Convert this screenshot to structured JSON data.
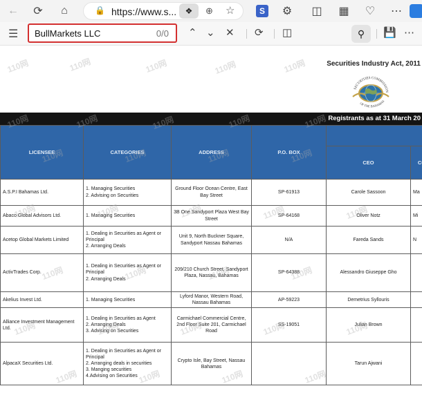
{
  "browser": {
    "url": "https://www.s...",
    "tab_icon_letter": "S"
  },
  "find": {
    "query": "BullMarkets LLC",
    "count": "0/0"
  },
  "document": {
    "act_title": "Securities Industry Act, 2011",
    "seal_top_text": "SECURITIES COMMISSION",
    "seal_bottom_text": "OF THE BAHAMAS",
    "registrants_label": "Registrants as at 31 March 20",
    "watermark": "110网",
    "headers": {
      "licensee": "LICENSEE",
      "categories": "CATEGORIES",
      "address": "ADDRESS",
      "po_box": "P.O. BOX",
      "ceo": "CEO",
      "co": "CO"
    },
    "rows": [
      {
        "licensee": "A.S.P.I Bahamas Ltd.",
        "categories": [
          "1. Managing Securities",
          "2. Advising on Securities"
        ],
        "address": "Ground Floor Ocean Centre, East Bay Street",
        "po_box": "SP-61913",
        "ceo": "Carole Sassoon",
        "co": "Ma"
      },
      {
        "licensee": "Abaco Global Advisors Ltd.",
        "categories": [
          "1. Managing Securities"
        ],
        "address": "3B One Sandyport Plaza West Bay Street",
        "po_box": "SP-64168",
        "ceo": "Oliver Notz",
        "co": "Mi"
      },
      {
        "licensee": "Acetop Global Markets Limited",
        "categories": [
          "1. Dealing in Securities as Agent or Principal",
          "2. Arranging Deals"
        ],
        "address": "Unit 9, North Buckner Square, Sandyport Nassau Bahamas",
        "po_box": "N/A",
        "ceo": "Fareda Sands",
        "co": "N"
      },
      {
        "licensee": "ActivTrades Corp.",
        "categories": [
          "1. Dealing in Securities as Agent or Principal",
          "2. Arranging Deals"
        ],
        "address": "209/210 Church Street, Sandyport Plaza, Nassau, Bahamas",
        "po_box": "SP-64388",
        "ceo": "Alessandro Giuseppe Gho",
        "co": ""
      },
      {
        "licensee": "Akelius Invest Ltd.",
        "categories": [
          "1. Managing Securities"
        ],
        "address": "Lyford Manor, Western Road, Nassau Bahamas",
        "po_box": "AP-59223",
        "ceo": "Demetrius Syllouris",
        "co": ""
      },
      {
        "licensee": "Alliance Investment Management Ltd.",
        "categories": [
          "1. Dealing in Securities as Agent",
          "2. Arranging Deals",
          "3. Advising on Securities"
        ],
        "address": "Carmichael Commercial Centre, 2nd Floor Suite 201, Carmichael Road",
        "po_box": "SS-19051",
        "ceo": "Julian Brown",
        "co": ""
      },
      {
        "licensee": "AlpacaX Securities Ltd.",
        "categories": [
          "1. Dealing in Securities as Agent or Principal",
          "2. Arranging deals in securities",
          "3. Manging securities",
          "4.Advising on Securities"
        ],
        "address": "Crypto Isle, Bay Street, Nassau Bahamas",
        "po_box": "",
        "ceo": "Tarun Ajwani",
        "co": ""
      }
    ]
  }
}
